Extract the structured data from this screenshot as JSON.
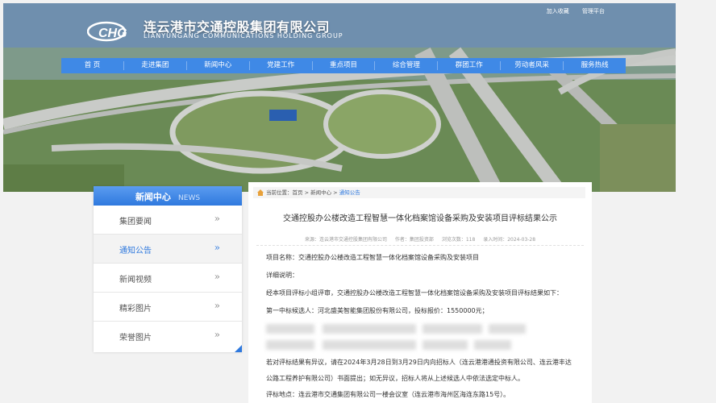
{
  "header": {
    "top_links": [
      "加入收藏",
      "管理平台"
    ],
    "logo_mark": "CHG",
    "company_cn": "连云港市交通控股集团有限公司",
    "company_en": "LIANYUNGANG COMMUNICATIONS HOLDING GROUP"
  },
  "nav": [
    "首 页",
    "走进集团",
    "新闻中心",
    "党建工作",
    "重点项目",
    "综合管理",
    "群团工作",
    "劳动者风采",
    "服务热线"
  ],
  "sidebar": {
    "title_cn": "新闻中心",
    "title_en": "NEWS",
    "items": [
      {
        "label": "集团要闻",
        "active": false
      },
      {
        "label": "通知公告",
        "active": true
      },
      {
        "label": "新闻视频",
        "active": false
      },
      {
        "label": "精彩图片",
        "active": false
      },
      {
        "label": "荣誉图片",
        "active": false
      }
    ],
    "chevron": "»"
  },
  "breadcrumb": {
    "prefix": "当前位置：",
    "home": "首页",
    "sep1": " > ",
    "section": "新闻中心",
    "sep2": " > ",
    "current": "通知公告"
  },
  "article": {
    "title": "交通控股办公楼改造工程智慧一体化档案馆设备采购及安装项目评标结果公示",
    "meta": {
      "source": "来源：连云港市交通控股集团有限公司",
      "author": "作者：集团投资部",
      "views": "浏览次数：118",
      "date": "录入时间：2024-03-28"
    },
    "paragraphs": [
      "项目名称：交通控股办公楼改造工程智慧一体化档案馆设备采购及安装项目",
      "详细说明：",
      "经本项目评标小组评审，交通控股办公楼改造工程智慧一体化档案馆设备采购及安装项目评标结果如下：",
      "第一中标候选人：河北盛美智能集团股份有限公司，投标报价：1550000元；"
    ],
    "objection": "若对评标结果有异议，请在2024年3月28日到3月29日内向招标人（连云港港通投资有限公司、连云港丰达公路工程养护有限公司）书面提出；如无异议，招标人将从上述候选人中依法选定中标人。",
    "location": "评标地点：连云港市交通集团有限公司一楼会议室（连云港市海州区海连东路15号）。"
  }
}
